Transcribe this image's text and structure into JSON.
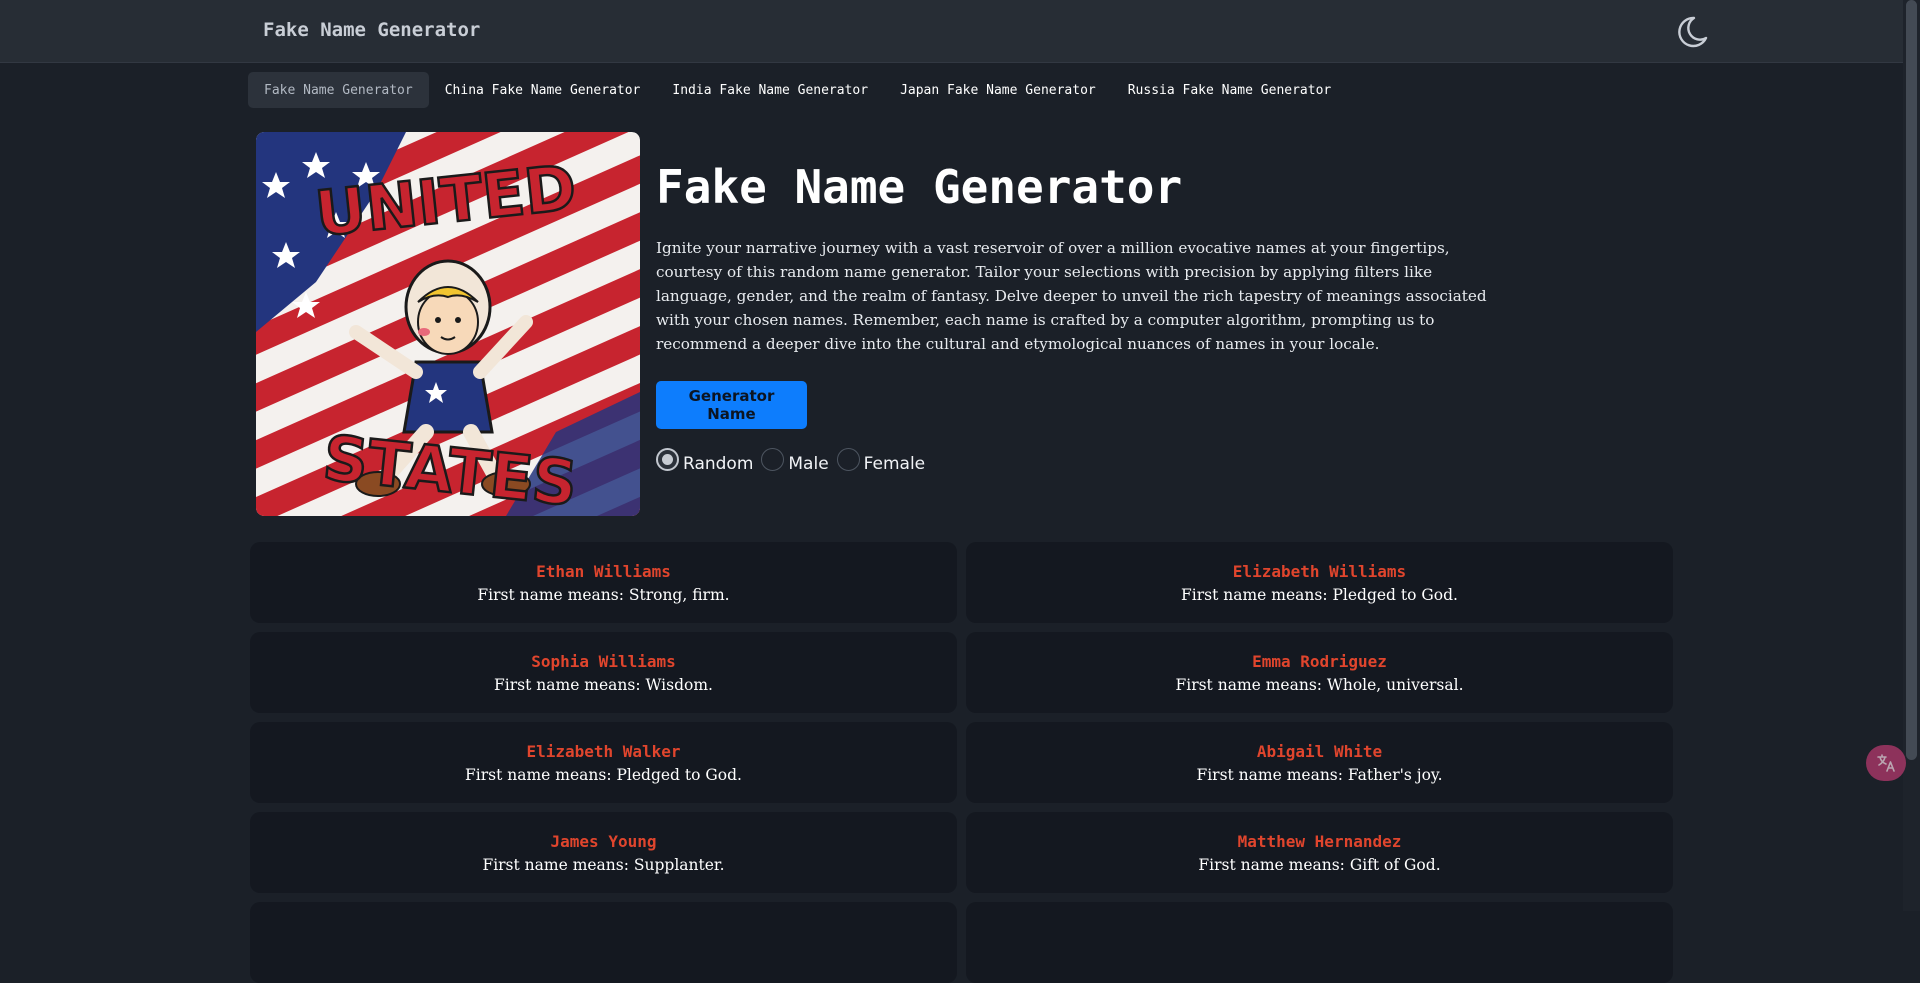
{
  "header": {
    "brand": "Fake Name Generator",
    "theme_toggle_icon": "moon-icon"
  },
  "nav": {
    "tabs": [
      {
        "label": "Fake Name Generator",
        "active": true
      },
      {
        "label": "China Fake Name Generator",
        "active": false
      },
      {
        "label": "India Fake Name Generator",
        "active": false
      },
      {
        "label": "Japan Fake Name Generator",
        "active": false
      },
      {
        "label": "Russia Fake Name Generator",
        "active": false
      }
    ]
  },
  "hero": {
    "image_text_top": "UNITED",
    "image_text_bottom": "STATES",
    "title": "Fake Name Generator",
    "description": "Ignite your narrative journey with a vast reservoir of over a million evocative names at your fingertips, courtesy of this random name generator. Tailor your selections with precision by applying filters like language, gender, and the realm of fantasy. Delve deeper to unveil the rich tapestry of meanings associated with your chosen names. Remember, each name is crafted by a computer algorithm, prompting us to recommend a deeper dive into the cultural and etymological nuances of names in your locale.",
    "button_label": "Generator Name",
    "gender_options": [
      {
        "label": "Random",
        "checked": true
      },
      {
        "label": "Male",
        "checked": false
      },
      {
        "label": "Female",
        "checked": false
      }
    ]
  },
  "names": [
    {
      "name": "Ethan Williams",
      "meaning": "First name means: Strong, firm."
    },
    {
      "name": "Elizabeth Williams",
      "meaning": "First name means: Pledged to God."
    },
    {
      "name": "Sophia Williams",
      "meaning": "First name means: Wisdom."
    },
    {
      "name": "Emma Rodriguez",
      "meaning": "First name means: Whole, universal."
    },
    {
      "name": "Elizabeth Walker",
      "meaning": "First name means: Pledged to God."
    },
    {
      "name": "Abigail White",
      "meaning": "First name means: Father's joy."
    },
    {
      "name": "James Young",
      "meaning": "First name means: Supplanter."
    },
    {
      "name": "Matthew Hernandez",
      "meaning": "First name means: Gift of God."
    }
  ],
  "translate_button_icon": "translate-icon",
  "colors": {
    "accent_button": "#0d7dfd",
    "name_color": "#e0452d",
    "background": "#1b2028",
    "card_background": "#141820"
  }
}
